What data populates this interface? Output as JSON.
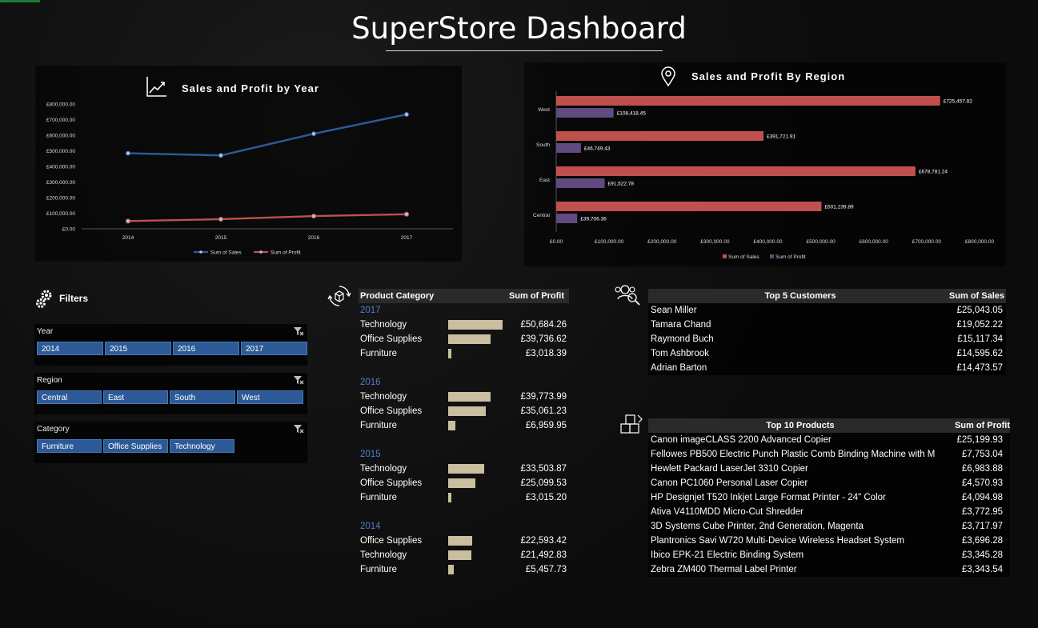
{
  "title": "SuperStore Dashboard",
  "colors": {
    "sales": "#c0504d",
    "profit_line": "#c0504d",
    "sales_line": "#2e5a9c",
    "profit_bar": "#604a80",
    "chip": "#2c5a96",
    "databar": "#c9bea0",
    "year": "#4d7fd1"
  },
  "line_chart": {
    "title": "Sales and Profit by Year",
    "icon": "trend-chart-icon",
    "legend": [
      "Sum of Sales",
      "Sum of Profit"
    ],
    "y_ticks": [
      "£800,000.00",
      "£700,000.00",
      "£600,000.00",
      "£500,000.00",
      "£400,000.00",
      "£300,000.00",
      "£200,000.00",
      "£100,000.00",
      "£0.00"
    ],
    "x_ticks": [
      "2014",
      "2015",
      "2016",
      "2017"
    ]
  },
  "bar_chart": {
    "title": "Sales and Profit By Region",
    "icon": "map-pin-icon",
    "legend": [
      "Sum of Sales",
      "Sum of Profit"
    ],
    "x_ticks": [
      "£0.00",
      "£100,000.00",
      "£200,000.00",
      "£300,000.00",
      "£400,000.00",
      "£500,000.00",
      "£600,000.00",
      "£700,000.00",
      "£800,000.00"
    ],
    "sales_labels": [
      "£725,457.82",
      "£391,721.91",
      "£678,781.24",
      "£501,239.89"
    ],
    "profit_labels": [
      "£108,418.45",
      "£46,749.43",
      "£91,522.78",
      "£39,706.36"
    ]
  },
  "chart_data": [
    {
      "type": "line",
      "title": "Sales and Profit by Year",
      "x": [
        "2014",
        "2015",
        "2016",
        "2017"
      ],
      "series": [
        {
          "name": "Sum of Sales",
          "values": [
            484247.5,
            470532.51,
            609205.6,
            733215.26
          ]
        },
        {
          "name": "Sum of Profit",
          "values": [
            49543.97,
            61618.6,
            81795.17,
            93439.27
          ]
        }
      ],
      "ylim": [
        0,
        800000
      ],
      "legend": "bottom"
    },
    {
      "type": "bar",
      "title": "Sales and Profit By Region",
      "orientation": "horizontal",
      "categories": [
        "West",
        "South",
        "East",
        "Central"
      ],
      "series": [
        {
          "name": "Sum of Sales",
          "values": [
            725457.82,
            391721.91,
            678781.24,
            501239.89
          ]
        },
        {
          "name": "Sum of Profit",
          "values": [
            108418.45,
            46749.43,
            91522.78,
            39706.36
          ]
        }
      ],
      "xlim": [
        0,
        800000
      ],
      "legend": "bottom"
    }
  ],
  "filters": {
    "heading": "Filters",
    "year": {
      "label": "Year",
      "options": [
        "2014",
        "2015",
        "2016",
        "2017"
      ]
    },
    "region": {
      "label": "Region",
      "options": [
        "Central",
        "East",
        "South",
        "West"
      ]
    },
    "category": {
      "label": "Category",
      "options": [
        "Furniture",
        "Office Supplies",
        "Technology"
      ]
    }
  },
  "category_table": {
    "col1": "Product Category",
    "col2": "Sum of Profit",
    "groups": [
      {
        "year": "2017",
        "rows": [
          {
            "name": "Technology",
            "value": "£50,684.26",
            "amount": 50684.26
          },
          {
            "name": "Office Supplies",
            "value": "£39,736.62",
            "amount": 39736.62
          },
          {
            "name": "Furniture",
            "value": "£3,018.39",
            "amount": 3018.39
          }
        ]
      },
      {
        "year": "2016",
        "rows": [
          {
            "name": "Technology",
            "value": "£39,773.99",
            "amount": 39773.99
          },
          {
            "name": "Office Supplies",
            "value": "£35,061.23",
            "amount": 35061.23
          },
          {
            "name": "Furniture",
            "value": "£6,959.95",
            "amount": 6959.95
          }
        ]
      },
      {
        "year": "2015",
        "rows": [
          {
            "name": "Technology",
            "value": "£33,503.87",
            "amount": 33503.87
          },
          {
            "name": "Office Supplies",
            "value": "£25,099.53",
            "amount": 25099.53
          },
          {
            "name": "Furniture",
            "value": "£3,015.20",
            "amount": 3015.2
          }
        ]
      },
      {
        "year": "2014",
        "rows": [
          {
            "name": "Office Supplies",
            "value": "£22,593.42",
            "amount": 22593.42
          },
          {
            "name": "Technology",
            "value": "£21,492.83",
            "amount": 21492.83
          },
          {
            "name": "Furniture",
            "value": "£5,457.73",
            "amount": 5457.73
          }
        ]
      }
    ]
  },
  "customers": {
    "col1": "Top 5 Customers",
    "col2": "Sum of Sales",
    "rows": [
      {
        "name": "Sean Miller",
        "value": "£25,043.05"
      },
      {
        "name": "Tamara Chand",
        "value": "£19,052.22"
      },
      {
        "name": "Raymond Buch",
        "value": "£15,117.34"
      },
      {
        "name": "Tom Ashbrook",
        "value": "£14,595.62"
      },
      {
        "name": "Adrian Barton",
        "value": "£14,473.57"
      }
    ]
  },
  "products": {
    "col1": "Top 10 Products",
    "col2": "Sum of Profit",
    "rows": [
      {
        "name": "Canon imageCLASS 2200 Advanced Copier",
        "value": "£25,199.93"
      },
      {
        "name": "Fellowes PB500 Electric Punch Plastic Comb Binding Machine with M",
        "value": "£7,753.04"
      },
      {
        "name": "Hewlett Packard LaserJet 3310 Copier",
        "value": "£6,983.88"
      },
      {
        "name": "Canon PC1060 Personal Laser Copier",
        "value": "£4,570.93"
      },
      {
        "name": "HP Designjet T520 Inkjet Large Format Printer - 24\" Color",
        "value": "£4,094.98"
      },
      {
        "name": "Ativa V4110MDD Micro-Cut Shredder",
        "value": "£3,772.95"
      },
      {
        "name": "3D Systems Cube Printer, 2nd Generation, Magenta",
        "value": "£3,717.97"
      },
      {
        "name": "Plantronics Savi W720 Multi-Device Wireless Headset System",
        "value": "£3,696.28"
      },
      {
        "name": "Ibico EPK-21 Electric Binding System",
        "value": "£3,345.28"
      },
      {
        "name": "Zebra ZM400 Thermal Label Printer",
        "value": "£3,343.54"
      }
    ]
  }
}
